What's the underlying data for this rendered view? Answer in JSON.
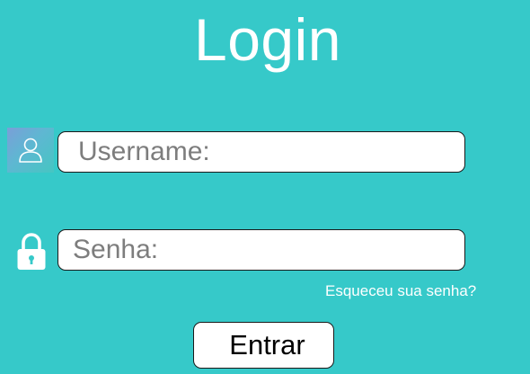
{
  "page": {
    "title": "Login"
  },
  "form": {
    "username": {
      "icon": "user-icon",
      "placeholder": "Username:",
      "value": ""
    },
    "password": {
      "icon": "lock-icon",
      "placeholder": "Senha:",
      "value": ""
    },
    "forgot_password_label": "Esqueceu sua senha?",
    "submit_label": "Entrar"
  },
  "colors": {
    "background": "#36C9C9",
    "field_background": "#FFFFFF",
    "placeholder_text": "#7D7D7D",
    "border": "#1A1A1A"
  }
}
